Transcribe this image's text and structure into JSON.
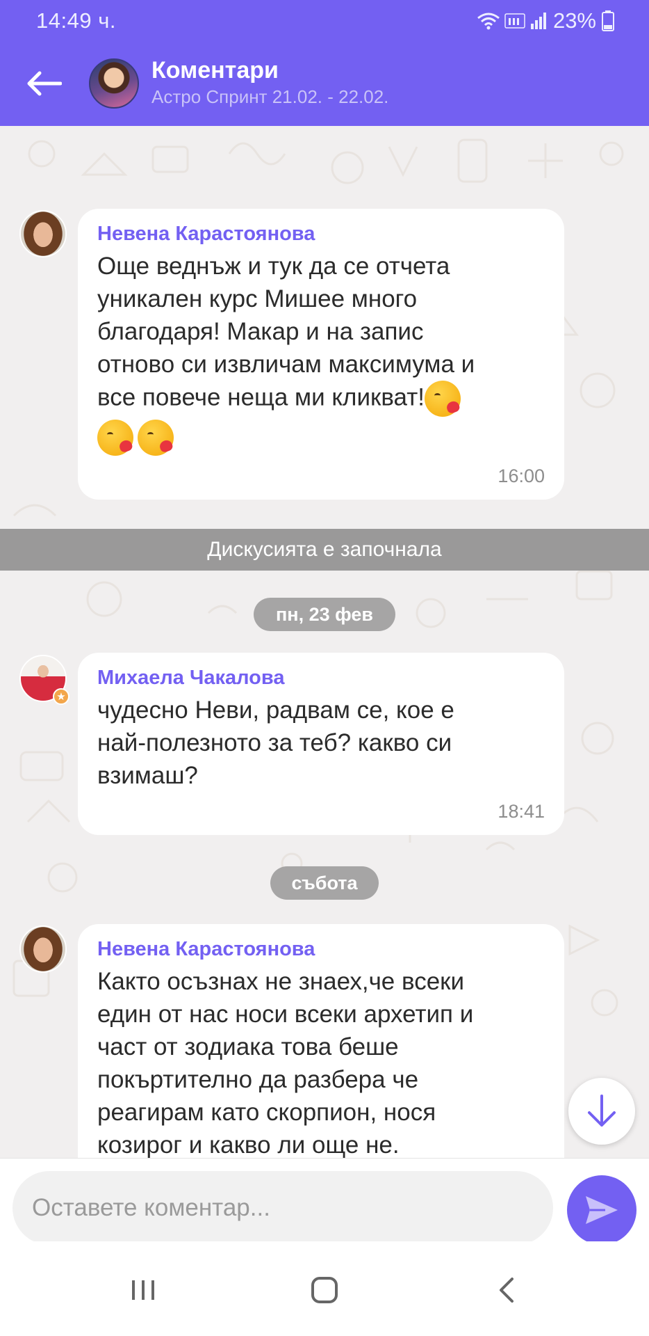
{
  "status_bar": {
    "time": "14:49 ч.",
    "battery": "23%"
  },
  "header": {
    "title": "Коментари",
    "subtitle": "Астро Спринт 21.02. - 22.02."
  },
  "messages": [
    {
      "sender": "Невена Карастоянова",
      "lines": [
        "Още веднъж и тук да се отчета",
        "уникален курс Мишее много",
        "благодаря! Макар и на запис",
        "отново си извличам максимума и",
        "все повече неща ми кликват!"
      ],
      "emoji": "face-blowing-kiss",
      "time": "16:00"
    },
    {
      "sender": "Михаела Чакалова",
      "lines": [
        "чудесно Неви, радвам се, кое е",
        "най-полезното за теб? какво си",
        "взимаш?"
      ],
      "time": "18:41"
    },
    {
      "sender": "Невена Карастоянова",
      "lines": [
        "Както осъзнах не знаех,че всеки",
        "един от нас носи всеки архетип и",
        "част от зодиака това беше",
        "покъртително да разбера че",
        "реагирам като скорпион, нося",
        "козирог и какво ли още не."
      ]
    }
  ],
  "system_banner": "Дискусията е започнала",
  "date_separators": [
    "пн, 23 фев",
    "събота"
  ],
  "composer": {
    "placeholder": "Оставете коментар..."
  },
  "colors": {
    "accent": "#7360f2",
    "banner": "#9a9999",
    "background": "#f1efef"
  }
}
